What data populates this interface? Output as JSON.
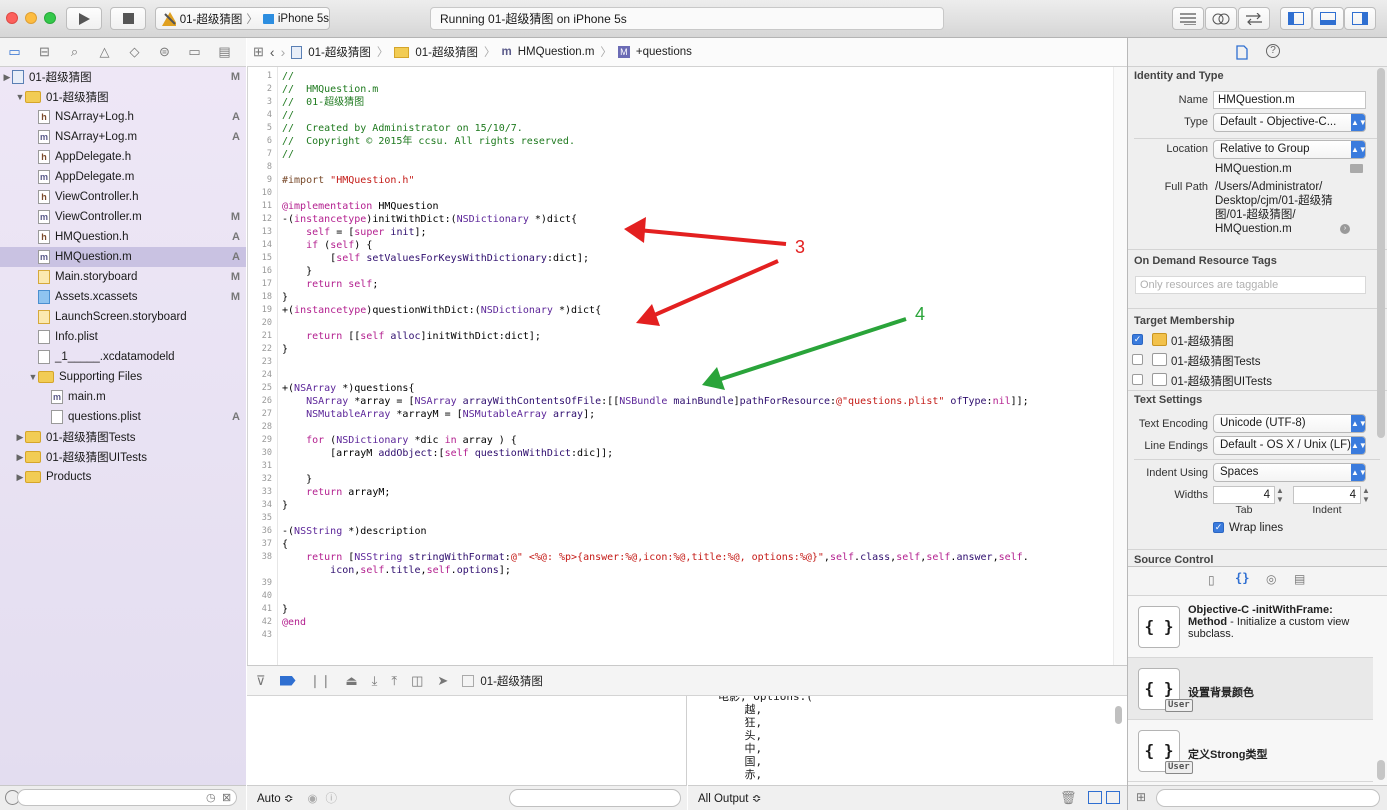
{
  "toolbar": {
    "scheme_target": "01-超级猜图",
    "scheme_device": "iPhone 5s",
    "status": "Running 01-超级猜图 on iPhone 5s"
  },
  "navigator": {
    "items": [
      {
        "label": "01-超级猜图",
        "type": "project",
        "indent": 0,
        "badge": "M",
        "disc": "▶"
      },
      {
        "label": "01-超级猜图",
        "type": "folder",
        "indent": 1,
        "badge": "",
        "disc": "▼"
      },
      {
        "label": "NSArray+Log.h",
        "type": "h",
        "indent": 2,
        "badge": "A",
        "disc": ""
      },
      {
        "label": "NSArray+Log.m",
        "type": "m",
        "indent": 2,
        "badge": "A",
        "disc": ""
      },
      {
        "label": "AppDelegate.h",
        "type": "h",
        "indent": 2,
        "badge": "",
        "disc": ""
      },
      {
        "label": "AppDelegate.m",
        "type": "m",
        "indent": 2,
        "badge": "",
        "disc": ""
      },
      {
        "label": "ViewController.h",
        "type": "h",
        "indent": 2,
        "badge": "",
        "disc": ""
      },
      {
        "label": "ViewController.m",
        "type": "m",
        "indent": 2,
        "badge": "M",
        "disc": ""
      },
      {
        "label": "HMQuestion.h",
        "type": "h",
        "indent": 2,
        "badge": "A",
        "disc": ""
      },
      {
        "label": "HMQuestion.m",
        "type": "m",
        "indent": 2,
        "badge": "A",
        "disc": "",
        "selected": true
      },
      {
        "label": "Main.storyboard",
        "type": "sb",
        "indent": 2,
        "badge": "M",
        "disc": ""
      },
      {
        "label": "Assets.xcassets",
        "type": "xc",
        "indent": 2,
        "badge": "M",
        "disc": ""
      },
      {
        "label": "LaunchScreen.storyboard",
        "type": "sb",
        "indent": 2,
        "badge": "",
        "disc": ""
      },
      {
        "label": "Info.plist",
        "type": "pl",
        "indent": 2,
        "badge": "",
        "disc": ""
      },
      {
        "label": "_1_____.xcdatamodeld",
        "type": "dm",
        "indent": 2,
        "badge": "",
        "disc": ""
      },
      {
        "label": "Supporting Files",
        "type": "folder",
        "indent": 2,
        "badge": "",
        "disc": "▼"
      },
      {
        "label": "main.m",
        "type": "m",
        "indent": 3,
        "badge": "",
        "disc": ""
      },
      {
        "label": "questions.plist",
        "type": "pl",
        "indent": 3,
        "badge": "A",
        "disc": ""
      },
      {
        "label": "01-超级猜图Tests",
        "type": "folder",
        "indent": 1,
        "badge": "",
        "disc": "▶"
      },
      {
        "label": "01-超级猜图UITests",
        "type": "folder",
        "indent": 1,
        "badge": "",
        "disc": "▶"
      },
      {
        "label": "Products",
        "type": "folder",
        "indent": 1,
        "badge": "",
        "disc": "▶"
      }
    ]
  },
  "jumpbar": {
    "crumbs": [
      "01-超级猜图",
      "01-超级猜图",
      "HMQuestion.m",
      "+questions"
    ]
  },
  "code": [
    [
      [
        "c",
        "//"
      ]
    ],
    [
      [
        "c",
        "//  HMQuestion.m"
      ]
    ],
    [
      [
        "c",
        "//  01-超级猜图"
      ]
    ],
    [
      [
        "c",
        "//"
      ]
    ],
    [
      [
        "c",
        "//  Created by Administrator on 15/10/7."
      ]
    ],
    [
      [
        "c",
        "//  Copyright © 2015年 ccsu. All rights reserved."
      ]
    ],
    [
      [
        "c",
        "//"
      ]
    ],
    [],
    [
      [
        "p",
        "#import "
      ],
      [
        "s",
        "\"HMQuestion.h\""
      ]
    ],
    [],
    [
      [
        "k",
        "@implementation"
      ],
      [
        "t",
        " HMQuestion"
      ]
    ],
    [
      [
        "t",
        "-("
      ],
      [
        "k",
        "instancetype"
      ],
      [
        "t",
        ")initWithDict:("
      ],
      [
        "y",
        "NSDictionary"
      ],
      [
        "t",
        " *)dict{"
      ]
    ],
    [
      [
        "t",
        "    "
      ],
      [
        "k",
        "self"
      ],
      [
        "t",
        " = ["
      ],
      [
        "k",
        "super"
      ],
      [
        "t",
        " "
      ],
      [
        "m",
        "init"
      ],
      [
        "t",
        "];"
      ]
    ],
    [
      [
        "t",
        "    "
      ],
      [
        "k",
        "if"
      ],
      [
        "t",
        " ("
      ],
      [
        "k",
        "self"
      ],
      [
        "t",
        ") {"
      ]
    ],
    [
      [
        "t",
        "        ["
      ],
      [
        "k",
        "self"
      ],
      [
        "t",
        " "
      ],
      [
        "m",
        "setValuesForKeysWithDictionary"
      ],
      [
        "t",
        ":dict];"
      ]
    ],
    [
      [
        "t",
        "    }"
      ]
    ],
    [
      [
        "t",
        "    "
      ],
      [
        "k",
        "return"
      ],
      [
        "t",
        " "
      ],
      [
        "k",
        "self"
      ],
      [
        "t",
        ";"
      ]
    ],
    [
      [
        "t",
        "}"
      ]
    ],
    [
      [
        "t",
        "+("
      ],
      [
        "k",
        "instancetype"
      ],
      [
        "t",
        ")questionWithDict:("
      ],
      [
        "y",
        "NSDictionary"
      ],
      [
        "t",
        " *)dict{"
      ]
    ],
    [],
    [
      [
        "t",
        "    "
      ],
      [
        "k",
        "return"
      ],
      [
        "t",
        " [["
      ],
      [
        "k",
        "self"
      ],
      [
        "t",
        " "
      ],
      [
        "m",
        "alloc"
      ],
      [
        "t",
        "]initWithDict:dict];"
      ]
    ],
    [
      [
        "t",
        "}"
      ]
    ],
    [],
    [],
    [
      [
        "t",
        "+("
      ],
      [
        "y",
        "NSArray"
      ],
      [
        "t",
        " *)questions{"
      ]
    ],
    [
      [
        "t",
        "    "
      ],
      [
        "y",
        "NSArray"
      ],
      [
        "t",
        " *array = ["
      ],
      [
        "y",
        "NSArray"
      ],
      [
        "t",
        " "
      ],
      [
        "m",
        "arrayWithContentsOfFile"
      ],
      [
        "t",
        ":[["
      ],
      [
        "y",
        "NSBundle"
      ],
      [
        "t",
        " "
      ],
      [
        "m",
        "mainBundle"
      ],
      [
        "t",
        "]"
      ],
      [
        "m",
        "pathForResource"
      ],
      [
        "t",
        ":"
      ],
      [
        "s",
        "@\"questions.plist\""
      ],
      [
        "t",
        " "
      ],
      [
        "m",
        "ofType"
      ],
      [
        "t",
        ":"
      ],
      [
        "k",
        "nil"
      ],
      [
        "t",
        "]];"
      ]
    ],
    [
      [
        "t",
        "    "
      ],
      [
        "y",
        "NSMutableArray"
      ],
      [
        "t",
        " *arrayM = ["
      ],
      [
        "y",
        "NSMutableArray"
      ],
      [
        "t",
        " "
      ],
      [
        "m",
        "array"
      ],
      [
        "t",
        "];"
      ]
    ],
    [],
    [
      [
        "t",
        "    "
      ],
      [
        "k",
        "for"
      ],
      [
        "t",
        " ("
      ],
      [
        "y",
        "NSDictionary"
      ],
      [
        "t",
        " *dic "
      ],
      [
        "k",
        "in"
      ],
      [
        "t",
        " array ) {"
      ]
    ],
    [
      [
        "t",
        "        [arrayM "
      ],
      [
        "m",
        "addObject"
      ],
      [
        "t",
        ":["
      ],
      [
        "k",
        "self"
      ],
      [
        "t",
        " "
      ],
      [
        "m",
        "questionWithDict"
      ],
      [
        "t",
        ":dic]];"
      ]
    ],
    [],
    [
      [
        "t",
        "    }"
      ]
    ],
    [
      [
        "t",
        "    "
      ],
      [
        "k",
        "return"
      ],
      [
        "t",
        " arrayM;"
      ]
    ],
    [
      [
        "t",
        "}"
      ]
    ],
    [],
    [
      [
        "t",
        "-("
      ],
      [
        "y",
        "NSString"
      ],
      [
        "t",
        " *)description"
      ]
    ],
    [
      [
        "t",
        "{"
      ]
    ],
    [
      [
        "t",
        "    "
      ],
      [
        "k",
        "return"
      ],
      [
        "t",
        " ["
      ],
      [
        "y",
        "NSString"
      ],
      [
        "t",
        " "
      ],
      [
        "m",
        "stringWithFormat"
      ],
      [
        "t",
        ":"
      ],
      [
        "s",
        "@\" <%@: %p>{answer:%@,icon:%@,title:%@, options:%@}\""
      ],
      [
        "t",
        ","
      ],
      [
        "k",
        "self"
      ],
      [
        "t",
        "."
      ],
      [
        "m",
        "class"
      ],
      [
        "t",
        ","
      ],
      [
        "k",
        "self"
      ],
      [
        "t",
        ","
      ],
      [
        "k",
        "self"
      ],
      [
        "t",
        "."
      ],
      [
        "m",
        "answer"
      ],
      [
        "t",
        ","
      ],
      [
        "k",
        "self"
      ],
      [
        "t",
        "."
      ]
    ],
    [
      [
        "t",
        "        "
      ],
      [
        "m",
        "icon"
      ],
      [
        "t",
        ","
      ],
      [
        "k",
        "self"
      ],
      [
        "t",
        "."
      ],
      [
        "m",
        "title"
      ],
      [
        "t",
        ","
      ],
      [
        "k",
        "self"
      ],
      [
        "t",
        "."
      ],
      [
        "m",
        "options"
      ],
      [
        "t",
        "];"
      ]
    ],
    [],
    [],
    [
      [
        "t",
        "}"
      ]
    ],
    [
      [
        "k",
        "@end"
      ]
    ],
    []
  ],
  "line_numbers": [
    "1",
    "2",
    "3",
    "4",
    "5",
    "6",
    "7",
    "8",
    "9",
    "10",
    "11",
    "12",
    "13",
    "14",
    "15",
    "16",
    "17",
    "18",
    "19",
    "20",
    "21",
    "22",
    "23",
    "24",
    "25",
    "26",
    "27",
    "28",
    "29",
    "30",
    "31",
    "32",
    "33",
    "34",
    "35",
    "36",
    "37",
    "38",
    "",
    "39",
    "40",
    "41",
    "42",
    "43"
  ],
  "annotations": {
    "arrow_a": "3",
    "arrow_b": "4"
  },
  "debug": {
    "target": "01-超级猜图",
    "auto_label": "Auto ≎",
    "output_label": "All Output ≎",
    "console": [
      "电影, Options:(",
      "    越,",
      "    狂,",
      "    头,",
      "    中,",
      "    国,",
      "    赤,"
    ]
  },
  "inspector": {
    "identity_title": "Identity and Type",
    "name_label": "Name",
    "name_value": "HMQuestion.m",
    "type_label": "Type",
    "type_value": "Default - Objective-C...",
    "location_label": "Location",
    "location_value": "Relative to Group",
    "location_file": "HMQuestion.m",
    "fullpath_label": "Full Path",
    "fullpath_lines": [
      "/Users/Administrator/",
      "Desktop/cjm/01-超级猜",
      "图/01-超级猜图/",
      "HMQuestion.m"
    ],
    "odr_title": "On Demand Resource Tags",
    "odr_placeholder": "Only resources are taggable",
    "membership_title": "Target Membership",
    "memberships": [
      {
        "label": "01-超级猜图",
        "checked": true
      },
      {
        "label": "01-超级猜图Tests",
        "checked": false
      },
      {
        "label": "01-超级猜图UITests",
        "checked": false
      }
    ],
    "text_title": "Text Settings",
    "encoding_label": "Text Encoding",
    "encoding_value": "Unicode (UTF-8)",
    "lineend_label": "Line Endings",
    "lineend_value": "Default - OS X / Unix (LF)",
    "indent_label": "Indent Using",
    "indent_value": "Spaces",
    "widths_label": "Widths",
    "tab_value": "4",
    "indent_width_value": "4",
    "tab_label": "Tab",
    "indent_sub_label": "Indent",
    "wrap_label": "Wrap lines",
    "source_title": "Source Control"
  },
  "snippets": [
    {
      "title": "Objective-C -initWithFrame:",
      "bold2": "Method",
      "desc": " - Initialize a custom view subclass.",
      "user": false
    },
    {
      "title": "设置背景颜色",
      "bold2": "",
      "desc": "",
      "user": true,
      "user_label": "User"
    },
    {
      "title": "定义Strong类型",
      "bold2": "",
      "desc": "",
      "user": true,
      "user_label": "User"
    }
  ],
  "colors": {
    "comment": "#1f7a1f",
    "keyword": "#b3208f",
    "string": "#c41a16",
    "type": "#5c2699",
    "method": "#2e0d6e",
    "preproc": "#78492a",
    "arrow_red": "#e32020",
    "arrow_green": "#2aa43a"
  }
}
